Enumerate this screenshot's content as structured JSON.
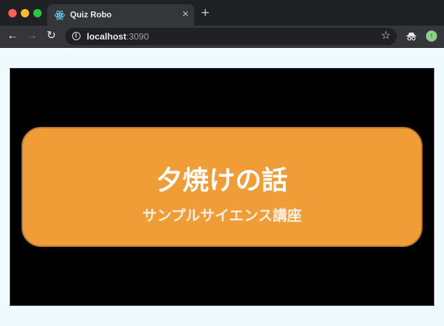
{
  "browser": {
    "tab": {
      "title": "Quiz Robo",
      "close_glyph": "×"
    },
    "new_tab_glyph": "+",
    "address": {
      "host": "localhost",
      "port": ":3090"
    },
    "icons": {
      "favicon": "react-atom-icon",
      "back": "arrow-left-icon",
      "forward": "arrow-right-icon",
      "reload": "reload-icon",
      "info": "info-icon",
      "bookmark": "star-icon",
      "extension": "incognito-extension-icon",
      "profile": "profile-update-icon"
    }
  },
  "page": {
    "card": {
      "title": "夕焼けの話",
      "subtitle": "サンプルサイエンス講座"
    },
    "colors": {
      "page_background": "#eefafd",
      "stage_background": "#000000",
      "card_background": "#f09d38",
      "card_border": "#b97a30"
    }
  }
}
